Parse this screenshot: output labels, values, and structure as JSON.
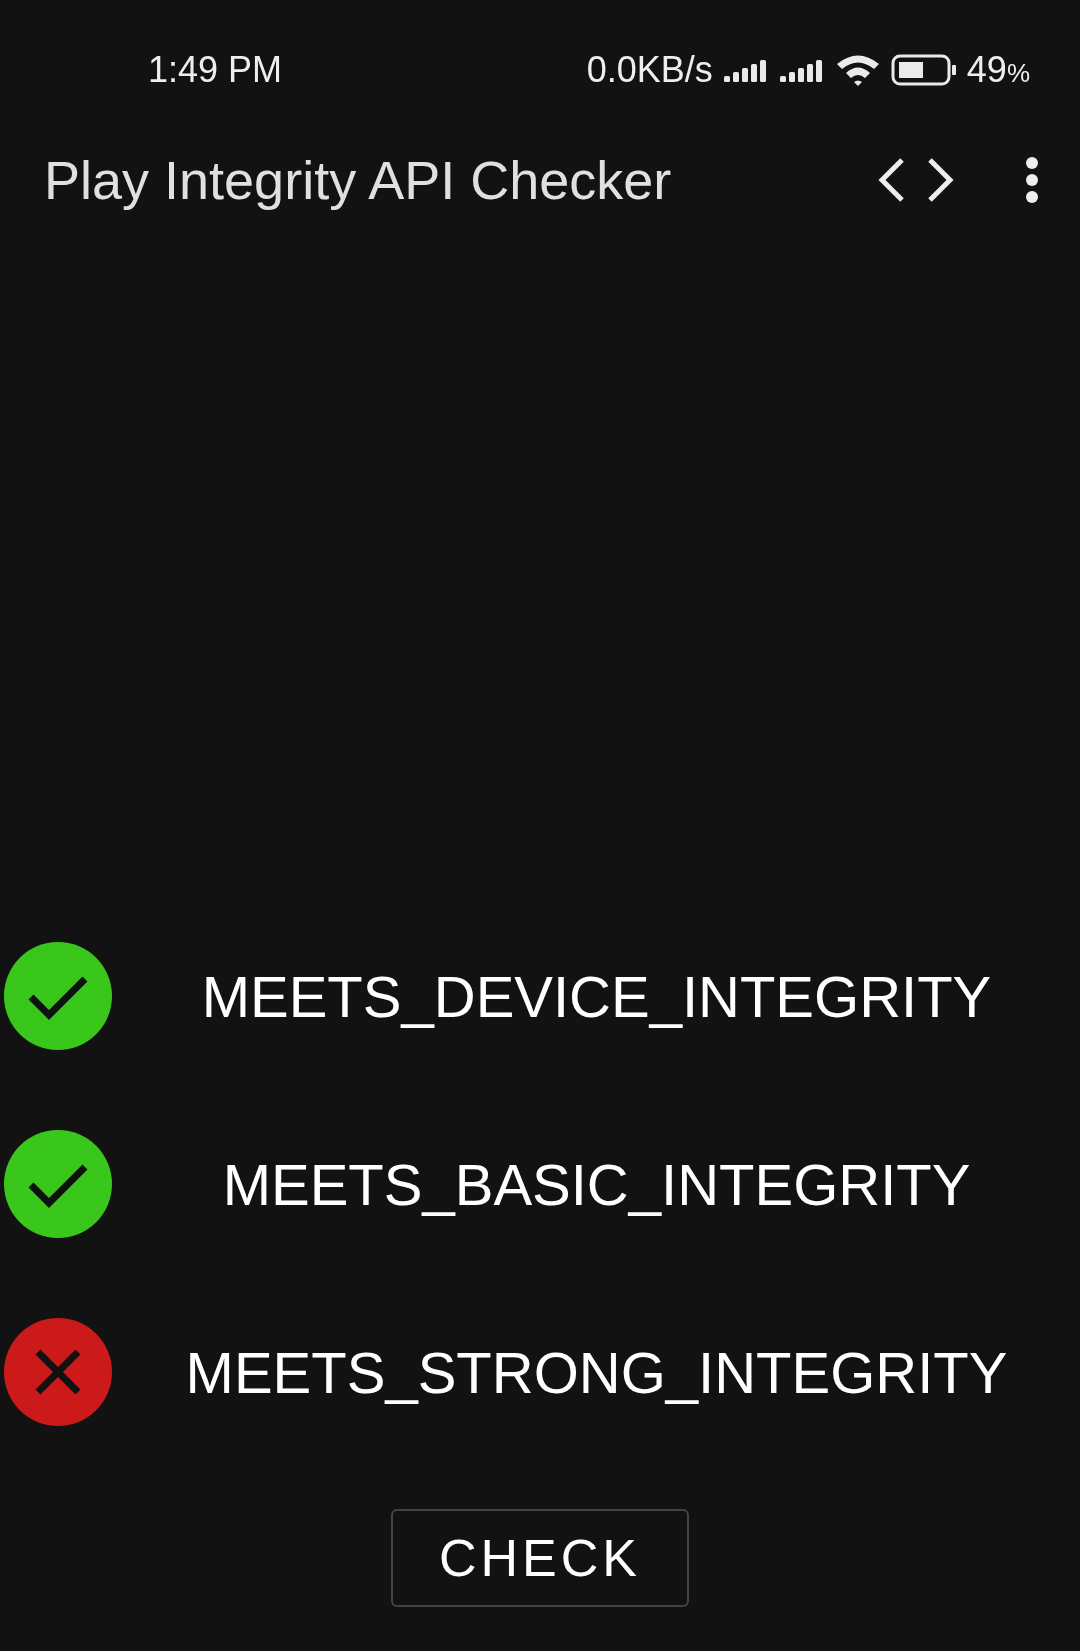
{
  "status_bar": {
    "time": "1:49 PM",
    "speed": "0.0KB/s",
    "battery": "49",
    "battery_unit": "%"
  },
  "app_bar": {
    "title": "Play Integrity API Checker"
  },
  "verdicts": [
    {
      "label": "MEETS_DEVICE_INTEGRITY",
      "passed": true
    },
    {
      "label": "MEETS_BASIC_INTEGRITY",
      "passed": true
    },
    {
      "label": "MEETS_STRONG_INTEGRITY",
      "passed": false
    }
  ],
  "check_button": "CHECK"
}
